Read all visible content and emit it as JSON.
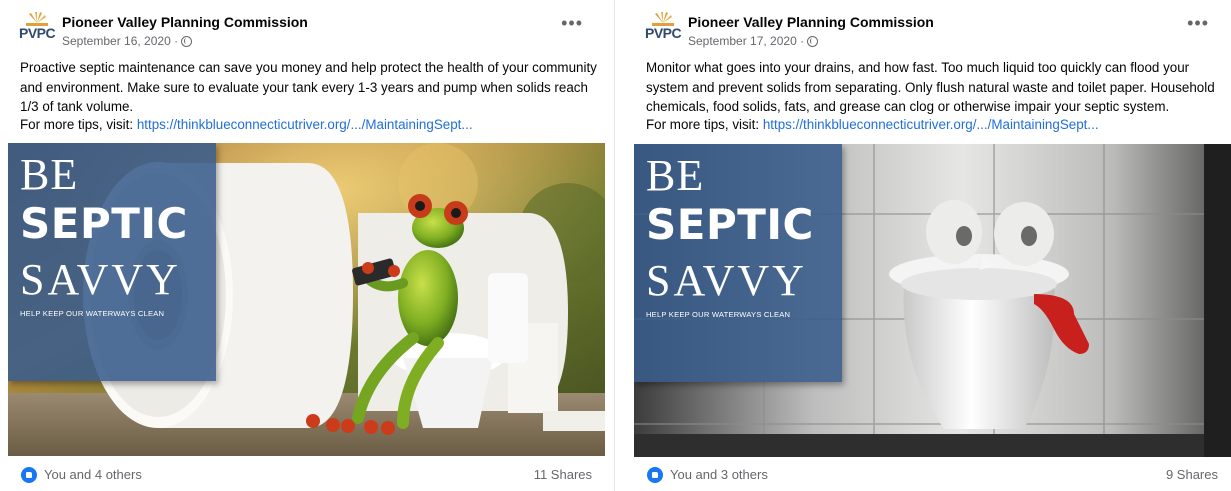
{
  "posts": [
    {
      "page_name": "Pioneer Valley Planning Commission",
      "logo_text": "PVPC",
      "date": "September 16, 2020 ·",
      "text": "Proactive septic maintenance can save you money and help protect the health of your community and environment. Make sure to evaluate your tank every 1-3 years and pump when solids reach 1/3 of tank volume.",
      "tips_label": "For more tips, visit:",
      "link": "https://thinkblueconnecticutriver.org/.../MaintainingSept...",
      "overlay": {
        "line1": "BE",
        "line2": "SEPTIC",
        "line3": "SAVVY",
        "tagline": "HELP KEEP OUR WATERWAYS CLEAN"
      },
      "reactions": "You and 4 others",
      "shares": "11 Shares"
    },
    {
      "page_name": "Pioneer Valley Planning Commission",
      "logo_text": "PVPC",
      "date": "September 17, 2020 ·",
      "text": "Monitor what goes into your drains, and how fast. Too much liquid too quickly can flood your system and prevent solids from separating. Only flush natural waste and toilet paper. Household chemicals, food solids, fats, and grease can clog or otherwise impair your septic system.",
      "tips_label": "For more tips, visit:",
      "link": "https://thinkblueconnecticutriver.org/.../MaintainingSept...",
      "overlay": {
        "line1": "BE",
        "line2": "SEPTIC",
        "line3": "SAVVY",
        "tagline": "HELP KEEP OUR WATERWAYS CLEAN"
      },
      "reactions": "You and 3 others",
      "shares": "9 Shares"
    }
  ],
  "colors": {
    "overlay_blue": "#385c8c",
    "link_blue": "#216fdb",
    "like_blue": "#1877f2",
    "meta_gray": "#65676b"
  },
  "icons": [
    "pvpc-logo",
    "globe-icon",
    "more-icon",
    "like-icon"
  ]
}
